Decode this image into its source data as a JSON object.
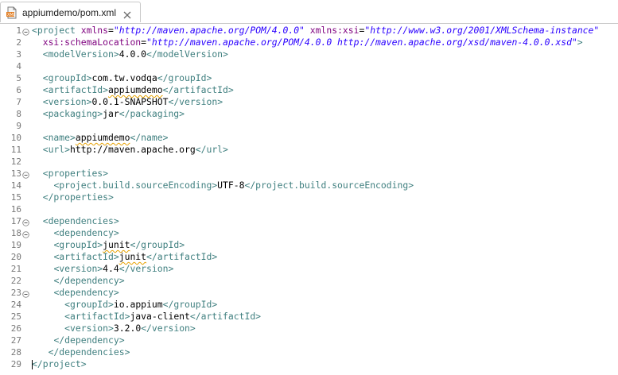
{
  "tab": {
    "title": "appiumdemo/pom.xml",
    "icon": "xml-file-icon",
    "close_icon": "close-icon"
  },
  "colors": {
    "tag": "#3f7f7f",
    "attr": "#7f007f",
    "string": "#2a00ff",
    "text": "#000000",
    "line_number": "#787878"
  },
  "lines": [
    {
      "n": "1",
      "fold": true,
      "tokens": [
        {
          "t": "tag",
          "v": "<project "
        },
        {
          "t": "attr",
          "v": "xmlns"
        },
        {
          "t": "txt",
          "v": "="
        },
        {
          "t": "str",
          "v": "\"http://maven.apache.org/POM/4.0.0\""
        },
        {
          "t": "txt",
          "v": " "
        },
        {
          "t": "attr",
          "v": "xmlns:xsi"
        },
        {
          "t": "txt",
          "v": "="
        },
        {
          "t": "str",
          "v": "\"http://www.w3.org/2001/XMLSchema-instance\""
        }
      ]
    },
    {
      "n": "2",
      "tokens": [
        {
          "t": "txt",
          "v": "  "
        },
        {
          "t": "attr",
          "v": "xsi:schemaLocation"
        },
        {
          "t": "txt",
          "v": "="
        },
        {
          "t": "str",
          "v": "\"http://maven.apache.org/POM/4.0.0 http://maven.apache.org/xsd/maven-4.0.0.xsd\""
        },
        {
          "t": "tag",
          "v": ">"
        }
      ]
    },
    {
      "n": "3",
      "tokens": [
        {
          "t": "txt",
          "v": "  "
        },
        {
          "t": "tag",
          "v": "<modelVersion>"
        },
        {
          "t": "txt",
          "v": "4.0.0"
        },
        {
          "t": "tag",
          "v": "</modelVersion>"
        }
      ]
    },
    {
      "n": "4",
      "tokens": []
    },
    {
      "n": "5",
      "tokens": [
        {
          "t": "txt",
          "v": "  "
        },
        {
          "t": "tag",
          "v": "<groupId>"
        },
        {
          "t": "txt",
          "v": "com.tw.vodqa"
        },
        {
          "t": "tag",
          "v": "</groupId>"
        }
      ]
    },
    {
      "n": "6",
      "tokens": [
        {
          "t": "txt",
          "v": "  "
        },
        {
          "t": "tag",
          "v": "<artifactId>"
        },
        {
          "t": "txt",
          "v": "appiumdemo",
          "spell": true
        },
        {
          "t": "tag",
          "v": "</artifactId>"
        }
      ]
    },
    {
      "n": "7",
      "tokens": [
        {
          "t": "txt",
          "v": "  "
        },
        {
          "t": "tag",
          "v": "<version>"
        },
        {
          "t": "txt",
          "v": "0.0.1-SNAPSHOT"
        },
        {
          "t": "tag",
          "v": "</version>"
        }
      ]
    },
    {
      "n": "8",
      "tokens": [
        {
          "t": "txt",
          "v": "  "
        },
        {
          "t": "tag",
          "v": "<packaging>"
        },
        {
          "t": "txt",
          "v": "jar"
        },
        {
          "t": "tag",
          "v": "</packaging>"
        }
      ]
    },
    {
      "n": "9",
      "tokens": []
    },
    {
      "n": "10",
      "tokens": [
        {
          "t": "txt",
          "v": "  "
        },
        {
          "t": "tag",
          "v": "<name>"
        },
        {
          "t": "txt",
          "v": "appiumdemo",
          "spell": true
        },
        {
          "t": "tag",
          "v": "</name>"
        }
      ]
    },
    {
      "n": "11",
      "tokens": [
        {
          "t": "txt",
          "v": "  "
        },
        {
          "t": "tag",
          "v": "<url>"
        },
        {
          "t": "txt",
          "v": "http://maven.apache.org"
        },
        {
          "t": "tag",
          "v": "</url>"
        }
      ]
    },
    {
      "n": "12",
      "tokens": []
    },
    {
      "n": "13",
      "fold": true,
      "tokens": [
        {
          "t": "txt",
          "v": "  "
        },
        {
          "t": "tag",
          "v": "<properties>"
        }
      ]
    },
    {
      "n": "14",
      "tokens": [
        {
          "t": "txt",
          "v": "    "
        },
        {
          "t": "tag",
          "v": "<project.build.sourceEncoding>"
        },
        {
          "t": "txt",
          "v": "UTF-8"
        },
        {
          "t": "tag",
          "v": "</project.build.sourceEncoding>"
        }
      ]
    },
    {
      "n": "15",
      "tokens": [
        {
          "t": "txt",
          "v": "  "
        },
        {
          "t": "tag",
          "v": "</properties>"
        }
      ]
    },
    {
      "n": "16",
      "tokens": []
    },
    {
      "n": "17",
      "fold": true,
      "tokens": [
        {
          "t": "txt",
          "v": "  "
        },
        {
          "t": "tag",
          "v": "<dependencies>"
        }
      ]
    },
    {
      "n": "18",
      "fold": true,
      "tokens": [
        {
          "t": "txt",
          "v": "    "
        },
        {
          "t": "tag",
          "v": "<dependency>"
        }
      ]
    },
    {
      "n": "19",
      "tokens": [
        {
          "t": "txt",
          "v": "    "
        },
        {
          "t": "tag",
          "v": "<groupId>"
        },
        {
          "t": "txt",
          "v": "junit",
          "spell": true
        },
        {
          "t": "tag",
          "v": "</groupId>"
        }
      ]
    },
    {
      "n": "20",
      "tokens": [
        {
          "t": "txt",
          "v": "    "
        },
        {
          "t": "tag",
          "v": "<artifactId>"
        },
        {
          "t": "txt",
          "v": "junit",
          "spell": true
        },
        {
          "t": "tag",
          "v": "</artifactId>"
        }
      ]
    },
    {
      "n": "21",
      "tokens": [
        {
          "t": "txt",
          "v": "    "
        },
        {
          "t": "tag",
          "v": "<version>"
        },
        {
          "t": "txt",
          "v": "4.4"
        },
        {
          "t": "tag",
          "v": "</version>"
        }
      ]
    },
    {
      "n": "22",
      "tokens": [
        {
          "t": "txt",
          "v": "    "
        },
        {
          "t": "tag",
          "v": "</dependency>"
        }
      ]
    },
    {
      "n": "23",
      "fold": true,
      "tokens": [
        {
          "t": "txt",
          "v": "    "
        },
        {
          "t": "tag",
          "v": "<dependency>"
        }
      ]
    },
    {
      "n": "24",
      "tokens": [
        {
          "t": "txt",
          "v": "      "
        },
        {
          "t": "tag",
          "v": "<groupId>"
        },
        {
          "t": "txt",
          "v": "io.appium"
        },
        {
          "t": "tag",
          "v": "</groupId>"
        }
      ]
    },
    {
      "n": "25",
      "tokens": [
        {
          "t": "txt",
          "v": "      "
        },
        {
          "t": "tag",
          "v": "<artifactId>"
        },
        {
          "t": "txt",
          "v": "java-client"
        },
        {
          "t": "tag",
          "v": "</artifactId>"
        }
      ]
    },
    {
      "n": "26",
      "tokens": [
        {
          "t": "txt",
          "v": "      "
        },
        {
          "t": "tag",
          "v": "<version>"
        },
        {
          "t": "txt",
          "v": "3.2.0"
        },
        {
          "t": "tag",
          "v": "</version>"
        }
      ]
    },
    {
      "n": "27",
      "tokens": [
        {
          "t": "txt",
          "v": "    "
        },
        {
          "t": "tag",
          "v": "</dependency>"
        }
      ]
    },
    {
      "n": "28",
      "tokens": [
        {
          "t": "txt",
          "v": "   "
        },
        {
          "t": "tag",
          "v": "</dependencies>"
        }
      ]
    },
    {
      "n": "29",
      "caret": true,
      "tokens": [
        {
          "t": "tag",
          "v": "</project>"
        }
      ]
    }
  ]
}
